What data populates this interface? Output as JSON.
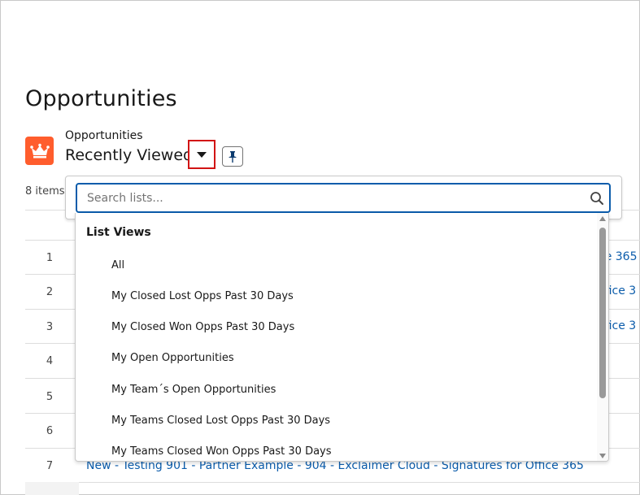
{
  "page": {
    "title": "Opportunities"
  },
  "header": {
    "object_label": "Opportunities",
    "view_name": "Recently Viewed",
    "icon": "crown-icon",
    "icon_color": "#ff5d2d"
  },
  "list_info": {
    "items_count": "8 items"
  },
  "table": {
    "rows": [
      {
        "num": "1",
        "link": "ce 365"
      },
      {
        "num": "2",
        "link": "ffice 3"
      },
      {
        "num": "3",
        "link": "ffice 3"
      },
      {
        "num": "4",
        "link": ""
      },
      {
        "num": "5",
        "link": ""
      },
      {
        "num": "6",
        "link": ""
      },
      {
        "num": "7",
        "link": "New - Testing 901 - Partner Example - 904 - Exclaimer Cloud - Signatures for Office 365"
      }
    ]
  },
  "dropdown": {
    "search_placeholder": "Search lists...",
    "section_header": "List Views",
    "items": [
      "All",
      "My Closed Lost Opps Past 30 Days",
      "My Closed Won Opps Past 30 Days",
      "My Open Opportunities",
      "My Team´s Open Opportunities",
      "My Teams Closed Lost Opps Past 30 Days",
      "My Teams Closed Won Opps Past 30 Days"
    ]
  },
  "colors": {
    "accent": "#0b5cab",
    "highlight_border": "#d21414",
    "link": "#0b5cab"
  }
}
